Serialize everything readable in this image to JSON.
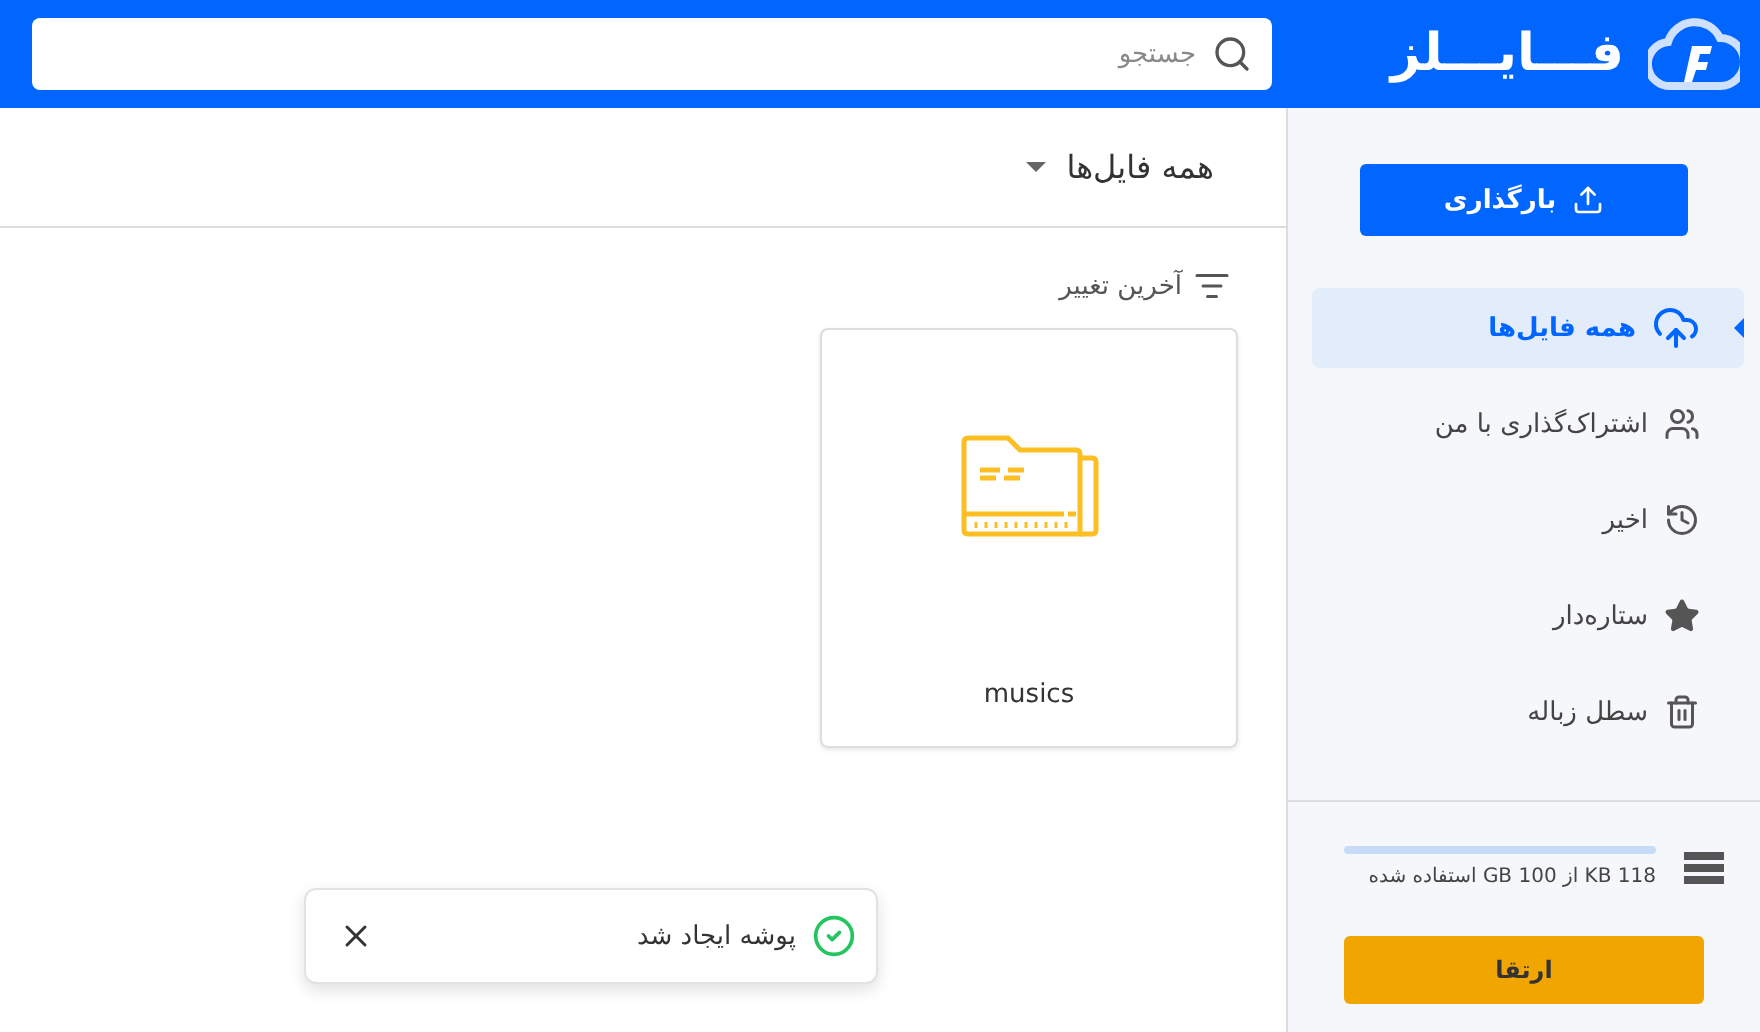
{
  "header": {
    "logo_text": "فـــایـــلز",
    "search": {
      "placeholder": "جستجو"
    }
  },
  "sidebar": {
    "upload_button": "بارگذاری",
    "items": [
      {
        "kind": "all",
        "label": "همه فایل‌ها",
        "selected": true
      },
      {
        "kind": "shared",
        "label": "اشتراک‌گذاری با من",
        "selected": false
      },
      {
        "kind": "recent",
        "label": "اخیر",
        "selected": false
      },
      {
        "kind": "starred",
        "label": "ستاره‌دار",
        "selected": false
      },
      {
        "kind": "trash",
        "label": "سطل زباله",
        "selected": false
      }
    ],
    "storage": {
      "level": 0,
      "text": "118 KB از 100 GB استفاده شده"
    },
    "upgrade_button": "ارتقا"
  },
  "main": {
    "title": "همه فایل‌ها",
    "sort_label": "آخرین تغییر",
    "folders": [
      {
        "name": "musics"
      }
    ]
  },
  "toast": {
    "message": "پوشه ایجاد شد"
  }
}
